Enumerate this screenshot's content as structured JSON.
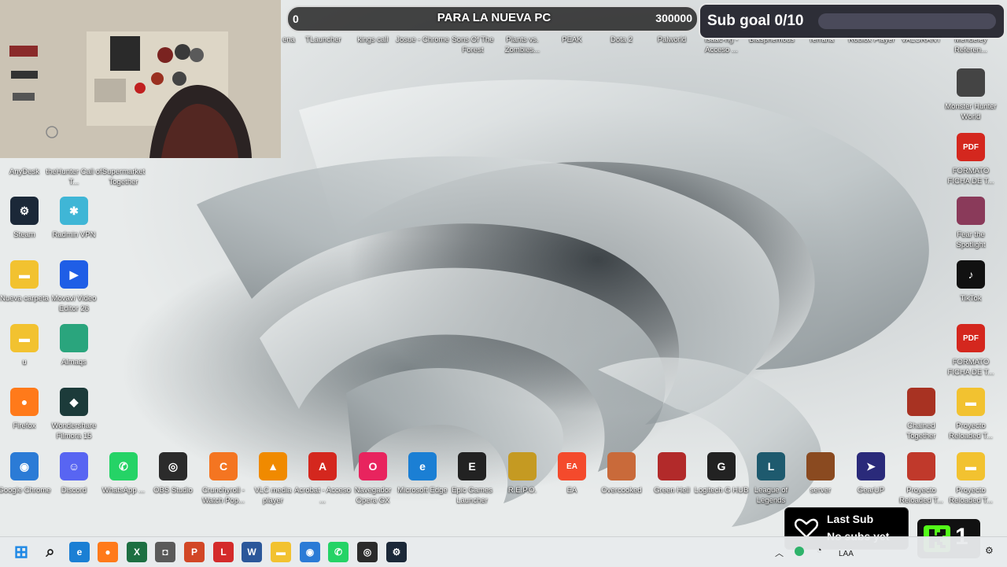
{
  "overlay": {
    "goal_start": "0",
    "goal_title": "PARA LA NUEVA PC",
    "goal_end": "300000",
    "sub_goal": "Sub goal 0/10",
    "last_sub_title": "Last Sub",
    "last_sub_value": "No subs yet",
    "kick_count": "1"
  },
  "top_row": [
    {
      "label": "ena",
      "icon": "app-icon",
      "color": "#5b5b5b"
    },
    {
      "label": "TLauncher",
      "icon": "minecraft-icon",
      "color": "#4f8a2c"
    },
    {
      "label": "kings call",
      "icon": "game-icon",
      "color": "#c76aa3"
    },
    {
      "label": "Josue - Chrome",
      "icon": "chrome-icon",
      "color": "#2b7bd6"
    },
    {
      "label": "Sons Of The Forest",
      "icon": "game-icon",
      "color": "#7a2a22"
    },
    {
      "label": "Plants vs. Zombies...",
      "icon": "game-icon",
      "color": "#5d3a8a"
    },
    {
      "label": "PEAK",
      "icon": "game-icon",
      "color": "#6b9fd3"
    },
    {
      "label": "Dota 2",
      "icon": "dota-icon",
      "color": "#b3262a"
    },
    {
      "label": "Palworld",
      "icon": "game-icon",
      "color": "#4cb1c9"
    },
    {
      "label": "Isaac-ng - Acceso ...",
      "icon": "game-icon",
      "color": "#8b6a4a"
    },
    {
      "label": "Blasphemous",
      "icon": "game-icon",
      "color": "#6a2f2a"
    },
    {
      "label": "Terraria",
      "icon": "game-icon",
      "color": "#3a7a3a"
    },
    {
      "label": "Roblox Player",
      "icon": "roblox-icon",
      "color": "#333333"
    },
    {
      "label": "VALORANT",
      "icon": "valorant-icon",
      "color": "#d33a47"
    },
    {
      "label": "Mendeley Referen...",
      "icon": "app-icon",
      "color": "#a5142a"
    }
  ],
  "left_icons": [
    {
      "label": "AnyDesk",
      "icon": "anydesk-icon",
      "color": "#e53935"
    },
    {
      "label": "theHunter Call of T...",
      "icon": "game-icon",
      "color": "#6b5a3a"
    },
    {
      "label": "Supermarket Together",
      "icon": "game-icon",
      "color": "#3b7fb7"
    },
    {
      "label": "Steam",
      "icon": "steam-icon",
      "color": "#1b2838"
    },
    {
      "label": "Radmin VPN",
      "icon": "radmin-icon",
      "color": "#3fb6d6"
    },
    {
      "label": "Nueva carpeta",
      "icon": "folder-icon",
      "color": "#f2c230"
    },
    {
      "label": "Movavi Video Editor 26",
      "icon": "movavi-icon",
      "color": "#1f5ee6"
    },
    {
      "label": "u",
      "icon": "folder-icon",
      "color": "#f2c230"
    },
    {
      "label": "Almaqs",
      "icon": "app-icon",
      "color": "#2aa57d"
    },
    {
      "label": "Firefox",
      "icon": "firefox-icon",
      "color": "#ff7a1a"
    },
    {
      "label": "Wondershare Filmora 15",
      "icon": "filmora-icon",
      "color": "#1c3b3a"
    }
  ],
  "bottom_row": [
    {
      "label": "Google Chrome",
      "icon": "chrome-icon",
      "color": "#2b7bd6"
    },
    {
      "label": "Discord",
      "icon": "discord-icon",
      "color": "#5865f2"
    },
    {
      "label": "WhatsApp ...",
      "icon": "whatsapp-icon",
      "color": "#25d366"
    },
    {
      "label": "OBS Studio",
      "icon": "obs-icon",
      "color": "#2b2b2b"
    },
    {
      "label": "Crunchyroll - Watch Pop...",
      "icon": "crunchyroll-icon",
      "color": "#f47521"
    },
    {
      "label": "VLC media player",
      "icon": "vlc-icon",
      "color": "#f08a00"
    },
    {
      "label": "Acrobat - Acceso ...",
      "icon": "acrobat-icon",
      "color": "#d4271e"
    },
    {
      "label": "Navegador Opera GX",
      "icon": "opera-icon",
      "color": "#e8245e"
    },
    {
      "label": "Microsoft Edge",
      "icon": "edge-icon",
      "color": "#1b7fd4"
    },
    {
      "label": "Epic Games Launcher",
      "icon": "epic-icon",
      "color": "#222222"
    },
    {
      "label": "R.E.P.O.",
      "icon": "game-icon",
      "color": "#c59a22"
    },
    {
      "label": "EA",
      "icon": "ea-icon",
      "color": "#f44a2c"
    },
    {
      "label": "Overcooked",
      "icon": "game-icon",
      "color": "#c96a3a"
    },
    {
      "label": "Green Hell",
      "icon": "game-icon",
      "color": "#b22a2a"
    },
    {
      "label": "Logitech G HUB",
      "icon": "logitech-icon",
      "color": "#222222"
    },
    {
      "label": "League of Legends",
      "icon": "lol-icon",
      "color": "#1e5a6e"
    },
    {
      "label": "server",
      "icon": "game-icon",
      "color": "#8a4a20"
    },
    {
      "label": "GearUP",
      "icon": "gearup-icon",
      "color": "#2a2a7a"
    },
    {
      "label": "Proyecto Reloaded T...",
      "icon": "app-icon",
      "color": "#c0392b"
    },
    {
      "label": "Proyecto Reloaded T...",
      "icon": "folder-icon",
      "color": "#f2c230"
    }
  ],
  "right_icons": [
    {
      "label": "Monster Hunter World",
      "icon": "game-icon",
      "color": "#444444"
    },
    {
      "label": "FORMATO FICHA DE T...",
      "icon": "pdf-icon",
      "color": "#d4271e"
    },
    {
      "label": "Fear the Spotlight",
      "icon": "game-icon",
      "color": "#8a3a5a"
    },
    {
      "label": "TikTok",
      "icon": "tiktok-icon",
      "color": "#111111"
    },
    {
      "label": "FORMATO FICHA DE T...",
      "icon": "pdf-icon",
      "color": "#d4271e"
    },
    {
      "label": "Chained Together",
      "icon": "game-icon",
      "color": "#a83222"
    },
    {
      "label": "Proyecto Reloaded T...",
      "icon": "folder-icon",
      "color": "#f2c230"
    }
  ],
  "taskbar": {
    "apps": [
      {
        "name": "start-button",
        "icon": "windows-icon",
        "color": "#1e88e5"
      },
      {
        "name": "search-button",
        "icon": "search-icon",
        "color": "#222222"
      },
      {
        "name": "edge-button",
        "icon": "edge-icon",
        "color": "#1b7fd4"
      },
      {
        "name": "firefox-button",
        "icon": "firefox-icon",
        "color": "#ff7a1a"
      },
      {
        "name": "excel-button",
        "icon": "excel-icon",
        "color": "#1d6f42"
      },
      {
        "name": "camera-button",
        "icon": "camera-icon",
        "color": "#5a5a5a"
      },
      {
        "name": "powerpoint-button",
        "icon": "powerpoint-icon",
        "color": "#d24726"
      },
      {
        "name": "app-l-button",
        "icon": "app-icon",
        "color": "#d42b2b"
      },
      {
        "name": "word-button",
        "icon": "word-icon",
        "color": "#2b579a"
      },
      {
        "name": "explorer-button",
        "icon": "folder-icon",
        "color": "#f2c230"
      },
      {
        "name": "chrome-button",
        "icon": "chrome-icon",
        "color": "#2b7bd6"
      },
      {
        "name": "whatsapp-button",
        "icon": "whatsapp-icon",
        "color": "#25d366"
      },
      {
        "name": "obs-button",
        "icon": "obs-icon",
        "color": "#2b2b2b"
      },
      {
        "name": "steam-button",
        "icon": "steam-icon",
        "color": "#1b2838"
      }
    ],
    "lang": "LAA"
  }
}
